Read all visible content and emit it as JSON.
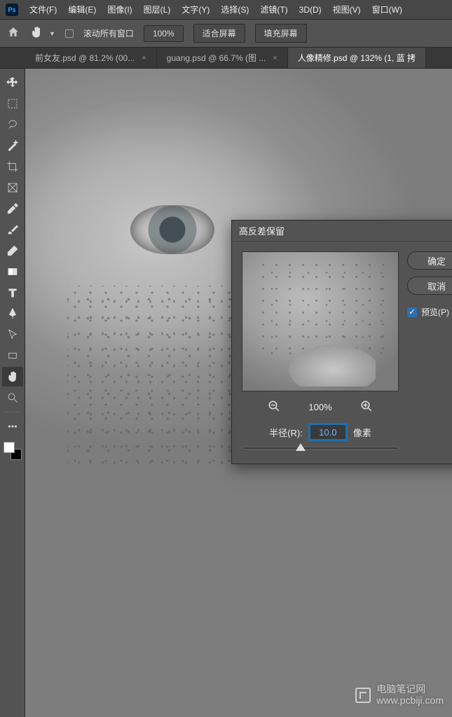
{
  "app": {
    "logo_text": "Ps"
  },
  "menu": {
    "items": [
      "文件(F)",
      "编辑(E)",
      "图像(I)",
      "图层(L)",
      "文字(Y)",
      "选择(S)",
      "滤镜(T)",
      "3D(D)",
      "视图(V)",
      "窗口(W)"
    ]
  },
  "option_bar": {
    "scroll_all_windows": "滚动所有窗口",
    "zoom_pct": "100%",
    "fit_screen": "适合屏幕",
    "fill_screen": "填充屏幕"
  },
  "tabs": [
    {
      "label": "前女友.psd @ 81.2% (00...",
      "active": false
    },
    {
      "label": "guang.psd @ 66.7% (图 ...",
      "active": false
    },
    {
      "label": "人像精修.psd @ 132% (1, 蓝 拷",
      "active": true
    }
  ],
  "dialog": {
    "title": "高反差保留",
    "ok": "确定",
    "cancel": "取消",
    "preview_label": "预览(P)",
    "preview_checked": true,
    "zoom_pct": "100%",
    "radius_label": "半径(R):",
    "radius_value": "10.0",
    "radius_unit": "像素"
  },
  "watermark": {
    "line1": "电脑笔记网",
    "line2": "www.pcbiji.com"
  }
}
